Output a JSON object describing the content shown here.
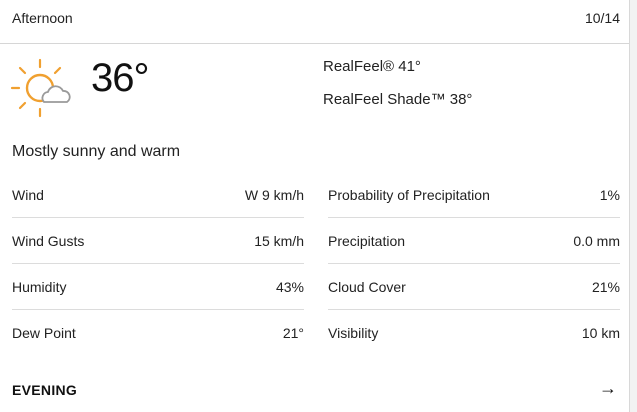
{
  "header": {
    "period": "Afternoon",
    "date": "10/14"
  },
  "current": {
    "icon": "mostly-sunny-icon",
    "temperature": "36°",
    "realfeel": "RealFeel® 41°",
    "realfeel_shade": "RealFeel Shade™ 38°",
    "phrase": "Mostly sunny and warm"
  },
  "stats_left": [
    {
      "label": "Wind",
      "value": "W 9 km/h"
    },
    {
      "label": "Wind Gusts",
      "value": "15 km/h"
    },
    {
      "label": "Humidity",
      "value": "43%"
    },
    {
      "label": "Dew Point",
      "value": "21°"
    }
  ],
  "stats_right": [
    {
      "label": "Probability of Precipitation",
      "value": "1%"
    },
    {
      "label": "Precipitation",
      "value": "0.0 mm"
    },
    {
      "label": "Cloud Cover",
      "value": "21%"
    },
    {
      "label": "Visibility",
      "value": "10 km"
    }
  ],
  "next": {
    "title": "EVENING",
    "icon": "arrow-right-icon"
  },
  "colors": {
    "sun": "#f0a030",
    "cloud": "#9a9a9a",
    "divider": "#dcdcdc"
  }
}
